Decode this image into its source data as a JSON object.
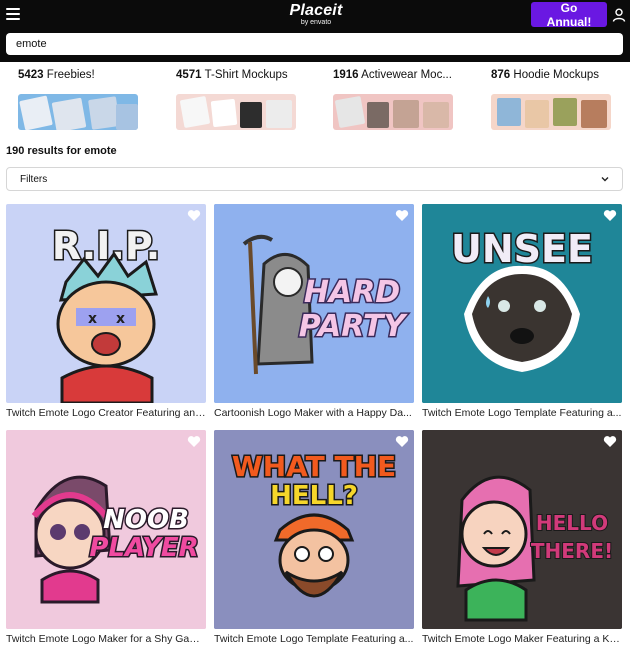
{
  "header": {
    "logo_main": "Placeit",
    "logo_sub": "by envato",
    "go_annual_label": "Go Annual!",
    "menu_icon": "hamburger-menu-icon",
    "user_icon": "user-icon"
  },
  "search": {
    "value": "emote"
  },
  "categories": [
    {
      "count": "5423",
      "label": "Freebies!"
    },
    {
      "count": "4571",
      "label": "T-Shirt Mockups"
    },
    {
      "count": "1916",
      "label": "Activewear Moc..."
    },
    {
      "count": "876",
      "label": "Hoodie Mockups"
    }
  ],
  "results": {
    "count_text": "190 results for",
    "query": "emote"
  },
  "filters": {
    "label": "Filters",
    "icon": "chevron-down-icon"
  },
  "cards": [
    {
      "title": "Twitch Emote Logo Creator Featuring an ...",
      "art_text": [
        "R.I.P."
      ],
      "bg": "#c9d3f6"
    },
    {
      "title": "Cartoonish Logo Maker with a Happy Da...",
      "art_text": [
        "HARD",
        "PARTY"
      ],
      "bg": "#8fb1ee"
    },
    {
      "title": "Twitch Emote Logo Template Featuring a...",
      "art_text": [
        "UNSEE"
      ],
      "bg": "#1f8698"
    },
    {
      "title": "Twitch Emote Logo Maker for a Shy Gami...",
      "art_text": [
        "NOOB",
        "PLAYER"
      ],
      "bg": "#f0c9dd"
    },
    {
      "title": "Twitch Emote Logo Template Featuring a...",
      "art_text": [
        "WHAT THE",
        "HELL?"
      ],
      "bg": "#8a8fbe"
    },
    {
      "title": "Twitch Emote Logo Maker Featuring a Ka...",
      "art_text": [
        "HELLO",
        "THERE!"
      ],
      "bg": "#3a3433"
    }
  ],
  "colors": {
    "accent": "#6a18e2",
    "header_bg": "#0b0b0b"
  }
}
